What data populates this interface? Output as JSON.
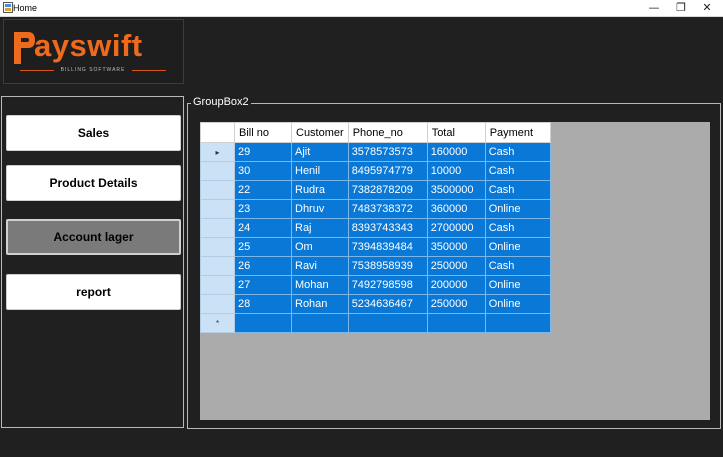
{
  "window": {
    "title": "Home",
    "minimize": "—",
    "maximize": "❐",
    "close": "✕"
  },
  "logo": {
    "text": "ayswift",
    "subtitle": "BILLING SOFTWARE",
    "color": "#f06a1e"
  },
  "nav": {
    "sales": "Sales",
    "product_details": "Product Details",
    "account_lager": "Account lager",
    "report": "report"
  },
  "groupbox": {
    "title": "GroupBox2"
  },
  "grid": {
    "columns": [
      "Bill no",
      "Customer",
      "Phone_no",
      "Total",
      "Payment"
    ],
    "rows": [
      [
        "29",
        "Ajit",
        "3578573573",
        "160000",
        "Cash"
      ],
      [
        "30",
        "Henil",
        "8495974779",
        "10000",
        "Cash"
      ],
      [
        "22",
        "Rudra",
        "7382878209",
        "3500000",
        "Cash"
      ],
      [
        "23",
        "Dhruv",
        "7483738372",
        "360000",
        "Online"
      ],
      [
        "24",
        "Raj",
        "8393743343",
        "2700000",
        "Cash"
      ],
      [
        "25",
        "Om",
        "7394839484",
        "350000",
        "Online"
      ],
      [
        "26",
        "Ravi",
        "7538958939",
        "250000",
        "Cash"
      ],
      [
        "27",
        "Mohan",
        "7492798598",
        "200000",
        "Online"
      ],
      [
        "28",
        "Rohan",
        "5234636467",
        "250000",
        "Online"
      ]
    ],
    "current_row_marker": "▸",
    "new_row_marker": "*",
    "selection_color": "#0a78d7"
  }
}
